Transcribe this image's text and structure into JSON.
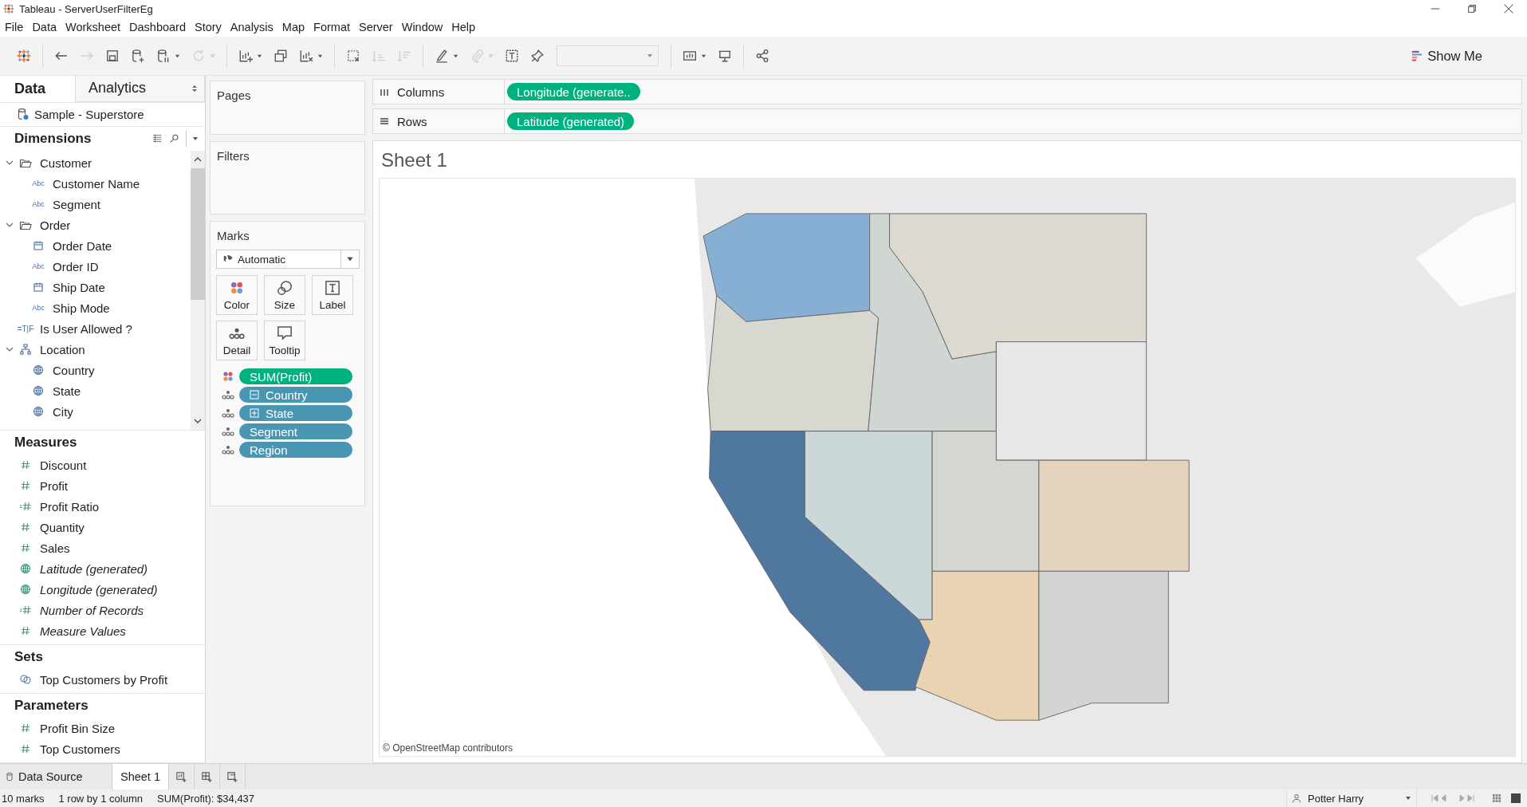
{
  "window": {
    "title": "Tableau - ServerUserFilterEg"
  },
  "menu": [
    "File",
    "Data",
    "Worksheet",
    "Dashboard",
    "Story",
    "Analysis",
    "Map",
    "Format",
    "Server",
    "Window",
    "Help"
  ],
  "toolbar": [
    {
      "kind": "icon",
      "disabled": false,
      "dropdown": false
    },
    {
      "kind": "separator"
    },
    {
      "kind": "icon",
      "disabled": false,
      "dropdown": false
    },
    {
      "kind": "icon",
      "disabled": true,
      "dropdown": false
    },
    {
      "kind": "icon",
      "disabled": false,
      "dropdown": false
    },
    {
      "kind": "icon",
      "disabled": false,
      "dropdown": false
    },
    {
      "kind": "icon",
      "disabled": false,
      "dropdown": true
    },
    {
      "kind": "icon",
      "disabled": true,
      "dropdown": true
    },
    {
      "kind": "separator"
    },
    {
      "kind": "icon",
      "disabled": false,
      "dropdown": true
    },
    {
      "kind": "icon",
      "disabled": false,
      "dropdown": false
    },
    {
      "kind": "icon",
      "disabled": false,
      "dropdown": true
    },
    {
      "kind": "separator"
    },
    {
      "kind": "icon",
      "disabled": false,
      "dropdown": false
    },
    {
      "kind": "icon",
      "disabled": true,
      "dropdown": false
    },
    {
      "kind": "icon",
      "disabled": true,
      "dropdown": false
    },
    {
      "kind": "separator"
    },
    {
      "kind": "icon",
      "disabled": false,
      "dropdown": true
    },
    {
      "kind": "icon",
      "disabled": true,
      "dropdown": true
    },
    {
      "kind": "icon",
      "disabled": false,
      "dropdown": false
    },
    {
      "kind": "icon",
      "disabled": false,
      "dropdown": false
    },
    {
      "kind": "combo",
      "disabled": true
    },
    {
      "kind": "separator"
    },
    {
      "kind": "icon",
      "disabled": false,
      "dropdown": true
    },
    {
      "kind": "icon",
      "disabled": false,
      "dropdown": false
    },
    {
      "kind": "separator"
    },
    {
      "kind": "icon",
      "disabled": false,
      "dropdown": false
    }
  ],
  "show_me": {
    "label": "Show Me"
  },
  "data_pane": {
    "tabs": [
      {
        "label": "Data",
        "selected": true
      },
      {
        "label": "Analytics",
        "selected": false
      }
    ],
    "datasource": "Sample - Superstore",
    "sections": [
      {
        "title": "Dimensions",
        "kind": "tree",
        "items": [
          {
            "label": "Customer",
            "kind": "folder",
            "expanded": true,
            "children": [
              {
                "label": "Customer Name",
                "kind": "string",
                "icon_text": "Abc"
              },
              {
                "label": "Segment",
                "kind": "string",
                "icon_text": "Abc"
              }
            ]
          },
          {
            "label": "Order",
            "kind": "folder",
            "expanded": true,
            "children": [
              {
                "label": "Order Date",
                "kind": "date"
              },
              {
                "label": "Order ID",
                "kind": "string",
                "icon_text": "Abc"
              },
              {
                "label": "Ship Date",
                "kind": "date"
              },
              {
                "label": "Ship Mode",
                "kind": "string",
                "icon_text": "Abc"
              }
            ]
          },
          {
            "label": "Is User Allowed ?",
            "kind": "bool",
            "icon_text": "=T|F"
          },
          {
            "label": "Location",
            "kind": "hierarchy",
            "expanded": true,
            "children": [
              {
                "label": "Country",
                "kind": "geo"
              },
              {
                "label": "State",
                "kind": "geo"
              },
              {
                "label": "City",
                "kind": "geo"
              }
            ]
          }
        ]
      },
      {
        "title": "Measures",
        "kind": "list",
        "items": [
          {
            "label": "Discount",
            "kind": "measure",
            "italic": false
          },
          {
            "label": "Profit",
            "kind": "measure",
            "italic": false
          },
          {
            "label": "Profit Ratio",
            "kind": "calc",
            "italic": false
          },
          {
            "label": "Quantity",
            "kind": "measure",
            "italic": false
          },
          {
            "label": "Sales",
            "kind": "measure",
            "italic": false
          },
          {
            "label": "Latitude (generated)",
            "kind": "geo",
            "italic": true
          },
          {
            "label": "Longitude (generated)",
            "kind": "geo",
            "italic": true
          },
          {
            "label": "Number of Records",
            "kind": "calc",
            "italic": true
          },
          {
            "label": "Measure Values",
            "kind": "measure",
            "italic": true
          }
        ]
      },
      {
        "title": "Sets",
        "kind": "list",
        "items": [
          {
            "label": "Top Customers by Profit",
            "kind": "set",
            "italic": false
          }
        ]
      },
      {
        "title": "Parameters",
        "kind": "list",
        "items": [
          {
            "label": "Profit Bin Size",
            "kind": "measure",
            "italic": false
          },
          {
            "label": "Top Customers",
            "kind": "measure",
            "italic": false
          }
        ]
      }
    ]
  },
  "pages": {
    "title": "Pages"
  },
  "filters": {
    "title": "Filters"
  },
  "marks": {
    "title": "Marks",
    "mark_type": "Automatic",
    "cards": [
      {
        "label": "Color",
        "kind": "color"
      },
      {
        "label": "Size",
        "kind": "size"
      },
      {
        "label": "Label",
        "kind": "label"
      },
      {
        "label": "Detail",
        "kind": "detail"
      },
      {
        "label": "Tooltip",
        "kind": "tooltip"
      }
    ],
    "pills": [
      {
        "label": "SUM(Profit)",
        "kind": "color",
        "color": "#00b180"
      },
      {
        "label": "Country",
        "kind": "detail",
        "color": "#4996b2",
        "expanded": true
      },
      {
        "label": "State",
        "kind": "detail",
        "color": "#4996b2",
        "expanded": false
      },
      {
        "label": "Segment",
        "kind": "detail",
        "color": "#4996b2"
      },
      {
        "label": "Region",
        "kind": "detail",
        "color": "#4996b2"
      }
    ]
  },
  "shelves": [
    {
      "label": "Columns",
      "kind": "columns",
      "pill": "Longitude (generate..",
      "color": "#00b180"
    },
    {
      "label": "Rows",
      "kind": "rows",
      "pill": "Latitude (generated)",
      "color": "#00b180"
    }
  ],
  "sheet": {
    "title": "Sheet 1",
    "map": {
      "kind": "picture",
      "attribution": "© OpenStreetMap contributors"
    }
  },
  "sheet_tabs": [
    {
      "label": "Data Source",
      "kind": "datasource",
      "selected": false
    },
    {
      "label": "Sheet 1",
      "kind": "sheet",
      "selected": true
    }
  ],
  "status_bar": {
    "marks": "10 marks",
    "layout": "1 row by 1 column",
    "summary": "SUM(Profit): $34,437",
    "user": "Potter Harry"
  }
}
